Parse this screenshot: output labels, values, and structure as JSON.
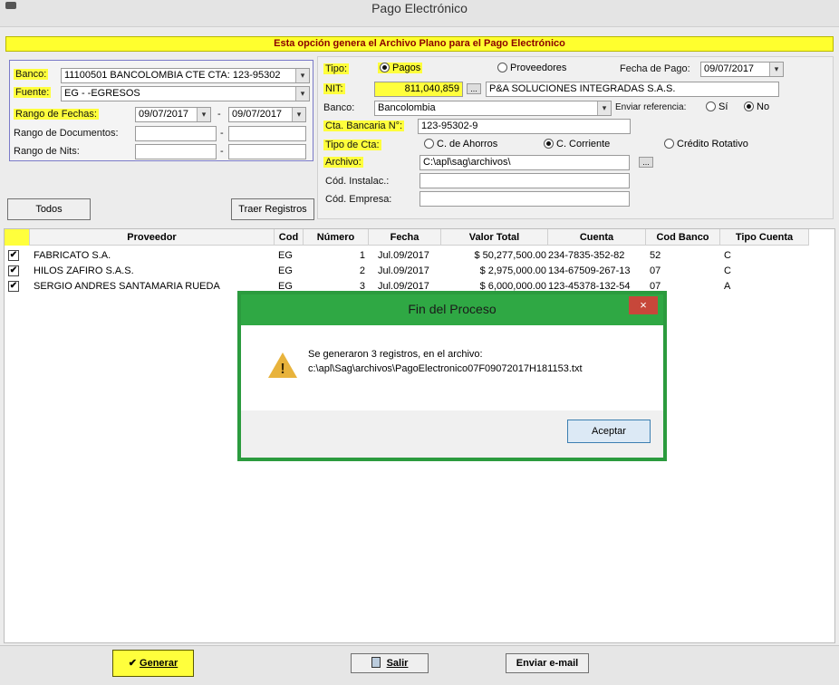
{
  "window": {
    "title": "Pago Electrónico"
  },
  "banner": "Esta opción genera el Archivo Plano para el Pago Electrónico",
  "left_panel": {
    "banco_label": "Banco:",
    "banco_value": "11100501 BANCOLOMBIA CTE CTA: 123-95302",
    "fuente_label": "Fuente:",
    "fuente_value": "EG - -EGRESOS",
    "rango_fechas_label": "Rango de Fechas:",
    "fecha_desde": "09/07/2017",
    "fecha_hasta": "09/07/2017",
    "rango_documentos_label": "Rango de Documentos:",
    "rango_nits_label": "Rango de Nits:",
    "dash": "-"
  },
  "buttons": {
    "todos": "Todos",
    "traer_registros": "Traer Registros",
    "generar": "Generar",
    "salir": "Salir",
    "enviar_email": "Enviar e-mail"
  },
  "right_panel": {
    "tipo_label": "Tipo:",
    "tipo_pagos": "Pagos",
    "tipo_proveedores": "Proveedores",
    "fecha_pago_label": "Fecha de Pago:",
    "fecha_pago_value": "09/07/2017",
    "nit_label": "NIT:",
    "nit_value": "811,040,859",
    "nit_name": "P&A SOLUCIONES INTEGRADAS S.A.S.",
    "banco_label": "Banco:",
    "banco_value": "Bancolombia",
    "enviar_ref_label": "Enviar referencia:",
    "si": "Sí",
    "no": "No",
    "cta_bancaria_label": "Cta. Bancaria N°:",
    "cta_bancaria_value": "123-95302-9",
    "tipo_cta_label": "Tipo de Cta:",
    "ahorros": "C. de Ahorros",
    "corriente": "C. Corriente",
    "rotativo": "Crédito Rotativo",
    "archivo_label": "Archivo:",
    "archivo_value": "C:\\apl\\sag\\archivos\\",
    "cod_instalac_label": "Cód. Instalac.:",
    "cod_empresa_label": "Cód. Empresa:"
  },
  "table": {
    "headers": [
      "Proveedor",
      "Cod",
      "Número",
      "Fecha",
      "Valor Total",
      "Cuenta",
      "Cod Banco",
      "Tipo Cuenta"
    ],
    "rows": [
      {
        "proveedor": "FABRICATO S.A.",
        "cod": "EG",
        "numero": "1",
        "fecha": "Jul.09/2017",
        "valor": "$ 50,277,500.00",
        "cuenta": "234-7835-352-82",
        "cod_banco": "52",
        "tipo": "C"
      },
      {
        "proveedor": "HILOS ZAFIRO S.A.S.",
        "cod": "EG",
        "numero": "2",
        "fecha": "Jul.09/2017",
        "valor": "$ 2,975,000.00",
        "cuenta": "134-67509-267-13",
        "cod_banco": "07",
        "tipo": "C"
      },
      {
        "proveedor": "SERGIO ANDRES SANTAMARIA RUEDA",
        "cod": "EG",
        "numero": "3",
        "fecha": "Jul.09/2017",
        "valor": "$ 6,000,000.00",
        "cuenta": "123-45378-132-54",
        "cod_banco": "07",
        "tipo": "A"
      }
    ]
  },
  "dialog": {
    "title": "Fin del Proceso",
    "close": "×",
    "line1": "Se generaron 3 registros, en el archivo:",
    "line2": "c:\\apl\\Sag\\archivos\\PagoElectronico07F09072017H181153.txt",
    "accept": "Aceptar"
  },
  "icons": {
    "combo": "▾",
    "check": "✔",
    "ellipsis": "...",
    "warning": "!"
  }
}
